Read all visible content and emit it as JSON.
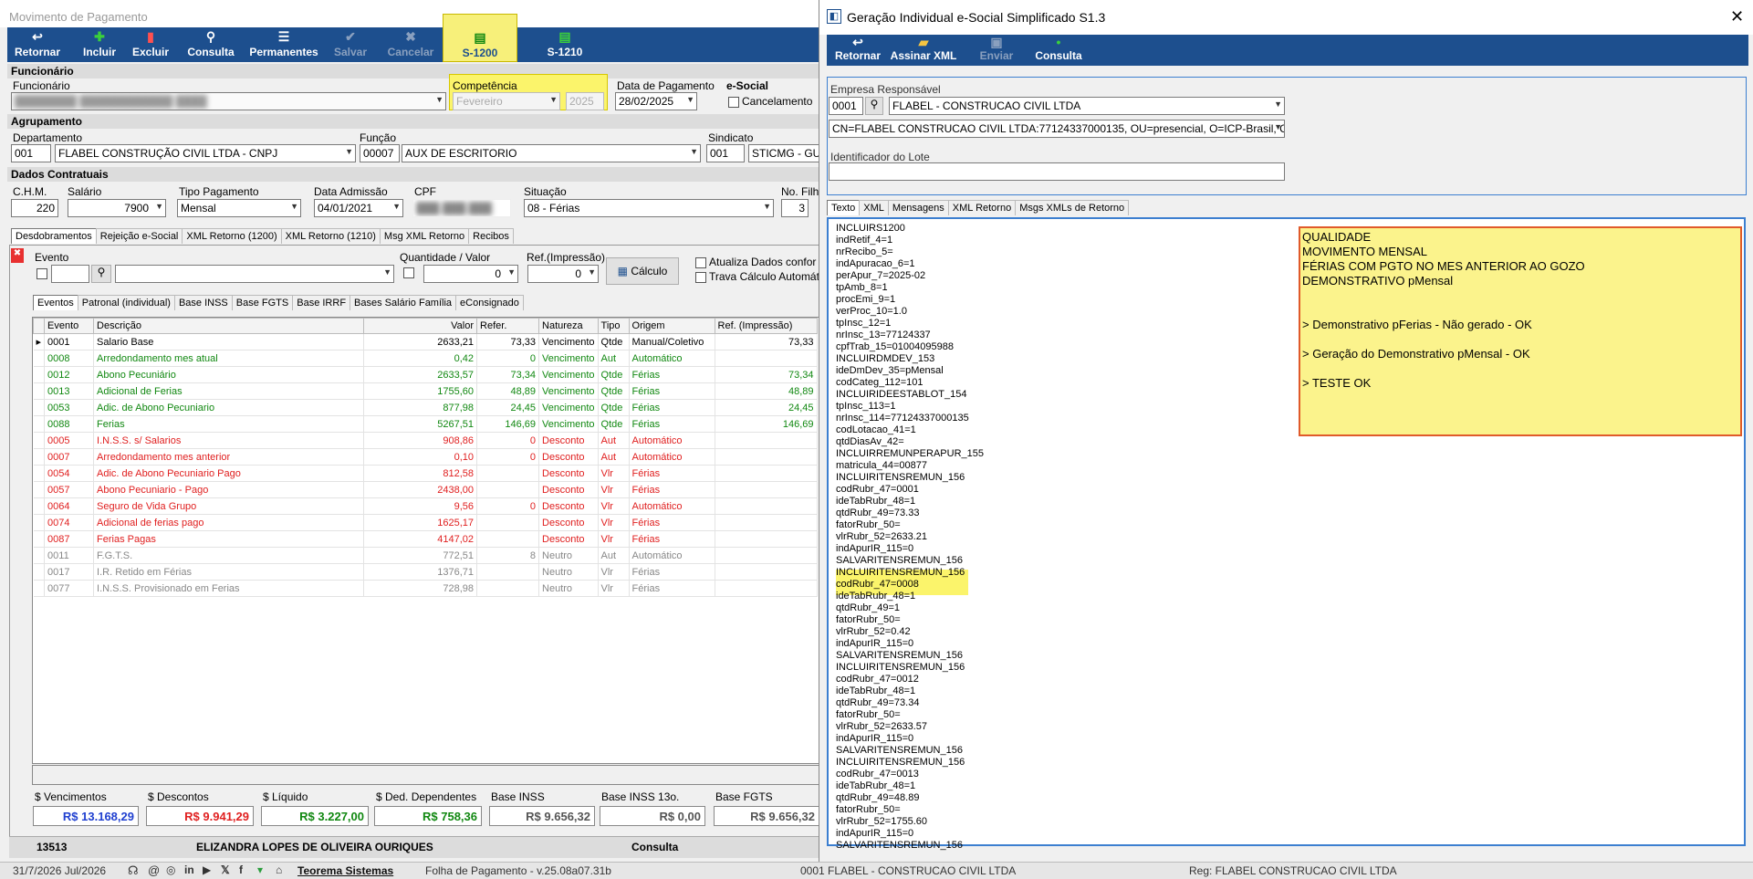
{
  "main": {
    "title": "Movimento de Pagamento",
    "toolbar": [
      "Retornar",
      "Incluir",
      "Excluir",
      "Consulta",
      "Permanentes",
      "Salvar",
      "Cancelar",
      "S-1200",
      "S-1210"
    ],
    "sections": {
      "funcionario": "Funcionário",
      "agrupamento": "Agrupamento",
      "dados": "Dados Contratuais"
    },
    "funcionario_label": "Funcionário",
    "competencia_label": "Competência",
    "competencia_mes": "Fevereiro",
    "competencia_ano": "2025",
    "data_pagamento_label": "Data de Pagamento",
    "data_pagamento": "28/02/2025",
    "esocial_label": "e-Social",
    "cancelamento_label": "Cancelamento",
    "departamento_label": "Departamento",
    "departamento_cod": "001",
    "departamento": "FLABEL CONSTRUÇÃO CIVIL LTDA - CNPJ",
    "funcao_label": "Função",
    "funcao_cod": "00007",
    "funcao": "AUX DE ESCRITORIO",
    "sindicato_label": "Sindicato",
    "sindicato_cod": "001",
    "sindicato": "STICMG - GUA",
    "chm_label": "C.H.M.",
    "chm": "220",
    "salario_label": "Salário",
    "salario": "7900",
    "tipo_pagamento_label": "Tipo Pagamento",
    "tipo_pagamento": "Mensal",
    "data_admissao_label": "Data Admissão",
    "data_admissao": "04/01/2021",
    "cpf_label": "CPF",
    "situacao_label": "Situação",
    "situacao": "08 - Férias",
    "filhos_label": "No. Filh",
    "filhos": "3",
    "tabs1": [
      "Desdobramentos",
      "Rejeição e-Social",
      "XML Retorno (1200)",
      "XML Retorno (1210)",
      "Msg XML Retorno",
      "Recibos"
    ],
    "evento_label": "Evento",
    "qtd_label": "Quantidade / Valor",
    "qtd_value": "0",
    "ref_label": "Ref.(Impressão)",
    "ref_value": "0",
    "calculo_btn": "Cálculo",
    "atualiza_label": "Atualiza Dados confor",
    "trava_label": "Trava Cálculo Automát",
    "tabs2": [
      "Eventos",
      "Patronal (individual)",
      "Base INSS",
      "Base FGTS",
      "Base IRRF",
      "Bases Salário Família",
      "eConsignado"
    ],
    "grid_headers": [
      "Evento",
      "Descrição",
      "Valor",
      "Refer.",
      "Natureza",
      "Tipo",
      "Origem",
      "Ref. (Impressão)"
    ],
    "grid_rows": [
      {
        "c": "blk",
        "ev": "0001",
        "desc": "Salario Base",
        "val": "2633,21",
        "ref": "73,33",
        "nat": "Vencimento",
        "tipo": "Qtde",
        "orig": "Manual/Coletivo",
        "imp": "73,33"
      },
      {
        "c": "green",
        "ev": "0008",
        "desc": "Arredondamento mes atual",
        "val": "0,42",
        "ref": "0",
        "nat": "Vencimento",
        "tipo": "Aut",
        "orig": "Automático",
        "imp": ""
      },
      {
        "c": "green",
        "ev": "0012",
        "desc": "Abono Pecuniário",
        "val": "2633,57",
        "ref": "73,34",
        "nat": "Vencimento",
        "tipo": "Qtde",
        "orig": "Férias",
        "imp": "73,34"
      },
      {
        "c": "green",
        "ev": "0013",
        "desc": "Adicional de Ferias",
        "val": "1755,60",
        "ref": "48,89",
        "nat": "Vencimento",
        "tipo": "Qtde",
        "orig": "Férias",
        "imp": "48,89"
      },
      {
        "c": "green",
        "ev": "0053",
        "desc": "Adic. de Abono Pecuniario",
        "val": "877,98",
        "ref": "24,45",
        "nat": "Vencimento",
        "tipo": "Qtde",
        "orig": "Férias",
        "imp": "24,45"
      },
      {
        "c": "green",
        "ev": "0088",
        "desc": "Ferias",
        "val": "5267,51",
        "ref": "146,69",
        "nat": "Vencimento",
        "tipo": "Qtde",
        "orig": "Férias",
        "imp": "146,69"
      },
      {
        "c": "red",
        "ev": "0005",
        "desc": "I.N.S.S. s/ Salarios",
        "val": "908,86",
        "ref": "0",
        "nat": "Desconto",
        "tipo": "Aut",
        "orig": "Automático",
        "imp": ""
      },
      {
        "c": "red",
        "ev": "0007",
        "desc": "Arredondamento mes anterior",
        "val": "0,10",
        "ref": "0",
        "nat": "Desconto",
        "tipo": "Aut",
        "orig": "Automático",
        "imp": ""
      },
      {
        "c": "red",
        "ev": "0054",
        "desc": "Adic. de Abono Pecuniario Pago",
        "val": "812,58",
        "ref": "",
        "nat": "Desconto",
        "tipo": "Vlr",
        "orig": "Férias",
        "imp": ""
      },
      {
        "c": "red",
        "ev": "0057",
        "desc": "Abono Pecuniario -  Pago",
        "val": "2438,00",
        "ref": "",
        "nat": "Desconto",
        "tipo": "Vlr",
        "orig": "Férias",
        "imp": ""
      },
      {
        "c": "red",
        "ev": "0064",
        "desc": "Seguro de Vida Grupo",
        "val": "9,56",
        "ref": "0",
        "nat": "Desconto",
        "tipo": "Vlr",
        "orig": "Automático",
        "imp": ""
      },
      {
        "c": "red",
        "ev": "0074",
        "desc": "Adicional de ferias pago",
        "val": "1625,17",
        "ref": "",
        "nat": "Desconto",
        "tipo": "Vlr",
        "orig": "Férias",
        "imp": ""
      },
      {
        "c": "red",
        "ev": "0087",
        "desc": "Ferias Pagas",
        "val": "4147,02",
        "ref": "",
        "nat": "Desconto",
        "tipo": "Vlr",
        "orig": "Férias",
        "imp": ""
      },
      {
        "c": "gray",
        "ev": "0011",
        "desc": "F.G.T.S.",
        "val": "772,51",
        "ref": "8",
        "nat": "Neutro",
        "tipo": "Aut",
        "orig": "Automático",
        "imp": ""
      },
      {
        "c": "gray",
        "ev": "0017",
        "desc": "I.R. Retido em Férias",
        "val": "1376,71",
        "ref": "",
        "nat": "Neutro",
        "tipo": "Vlr",
        "orig": "Férias",
        "imp": ""
      },
      {
        "c": "gray",
        "ev": "0077",
        "desc": "I.N.S.S. Provisionado em Ferias",
        "val": "728,98",
        "ref": "",
        "nat": "Neutro",
        "tipo": "Vlr",
        "orig": "Férias",
        "imp": ""
      }
    ],
    "totals": [
      {
        "label": "$ Vencimentos",
        "value": "R$ 13.168,29",
        "color": "#2040d0"
      },
      {
        "label": "$ Descontos",
        "value": "R$ 9.941,29",
        "color": "#e02020"
      },
      {
        "label": "$ Líquido",
        "value": "R$ 3.227,00",
        "color": "#118811"
      },
      {
        "label": "$ Ded. Dependentes",
        "value": "R$ 758,36",
        "color": "#118811"
      },
      {
        "label": "Base INSS",
        "value": "R$ 9.656,32",
        "color": "#555555"
      },
      {
        "label": "Base INSS 13o.",
        "value": "R$ 0,00",
        "color": "#555555"
      },
      {
        "label": "Base FGTS",
        "value": "R$ 9.656,32",
        "color": "#555555"
      }
    ],
    "footer_code": "13513",
    "footer_name": "ELIZANDRA LOPES DE OLIVEIRA OURIQUES",
    "footer_mode": "Consulta"
  },
  "status": {
    "date": "31/7/2026 Jul/2026",
    "brand": "Teorema Sistemas",
    "version": "Folha de Pagamento - v.25.08a07.31b",
    "company": "0001 FLABEL - CONSTRUCAO CIVIL LTDA",
    "reg": "Reg: FLABEL CONSTRUCAO CIVIL LTDA"
  },
  "right": {
    "title": "Geração Individual e-Social Simplificado S1.3",
    "toolbar": [
      "Retornar",
      "Assinar XML",
      "Enviar",
      "Consulta"
    ],
    "empresa_label": "Empresa Responsável",
    "empresa_cod": "0001",
    "empresa": "FLABEL - CONSTRUCAO CIVIL LTDA",
    "certificado": "CN=FLABEL CONSTRUCAO CIVIL LTDA:77124337000135, OU=presencial, O=ICP-Brasil, C=BR, S=l",
    "lote_label": "Identificador do Lote",
    "tabs": [
      "Texto",
      "XML",
      "Mensagens",
      "XML Retorno",
      "Msgs XMLs de Retorno"
    ],
    "payload": "INCLUIRS1200\nindRetif_4=1\nnrRecibo_5=\nindApuracao_6=1\nperApur_7=2025-02\ntpAmb_8=1\nprocEmi_9=1\nverProc_10=1.0\ntpInsc_12=1\nnrInsc_13=77124337\ncpfTrab_15=01004095988\nINCLUIRDMDEV_153\nideDmDev_35=pMensal\ncodCateg_112=101\nINCLUIRIDEESTABLOT_154\ntpInsc_113=1\nnrInsc_114=77124337000135\ncodLotacao_41=1\nqtdDiasAv_42=\nINCLUIRREMUNPERAPUR_155\nmatricula_44=00877\nINCLUIRITENSREMUN_156\ncodRubr_47=0001\nideTabRubr_48=1\nqtdRubr_49=73.33\nfatorRubr_50=\nvlrRubr_52=2633.21\nindApurIR_115=0\nSALVARITENSREMUN_156\nINCLUIRITENSREMUN_156\ncodRubr_47=0008\nideTabRubr_48=1\nqtdRubr_49=1\nfatorRubr_50=\nvlrRubr_52=0.42\nindApurIR_115=0\nSALVARITENSREMUN_156\nINCLUIRITENSREMUN_156\ncodRubr_47=0012\nideTabRubr_48=1\nqtdRubr_49=73.34\nfatorRubr_50=\nvlrRubr_52=2633.57\nindApurIR_115=0\nSALVARITENSREMUN_156\nINCLUIRITENSREMUN_156\ncodRubr_47=0013\nideTabRubr_48=1\nqtdRubr_49=48.89\nfatorRubr_50=\nvlrRubr_52=1755.60\nindApurIR_115=0\nSALVARITENSREMUN_156",
    "notes": [
      "QUALIDADE",
      "MOVIMENTO MENSAL",
      "FÉRIAS COM PGTO NO MES ANTERIOR AO GOZO",
      "DEMONSTRATIVO pMensal",
      "",
      "",
      "> Demonstrativo pFerias - Não gerado - OK",
      "",
      "> Geração do Demonstrativo pMensal - OK",
      "",
      "> TESTE OK"
    ]
  },
  "colors": {
    "toolbar": "#1d4f8e",
    "highlight": "#fbf46b",
    "notes_border": "#e05a2a",
    "green": "#118811",
    "red": "#e02020"
  }
}
